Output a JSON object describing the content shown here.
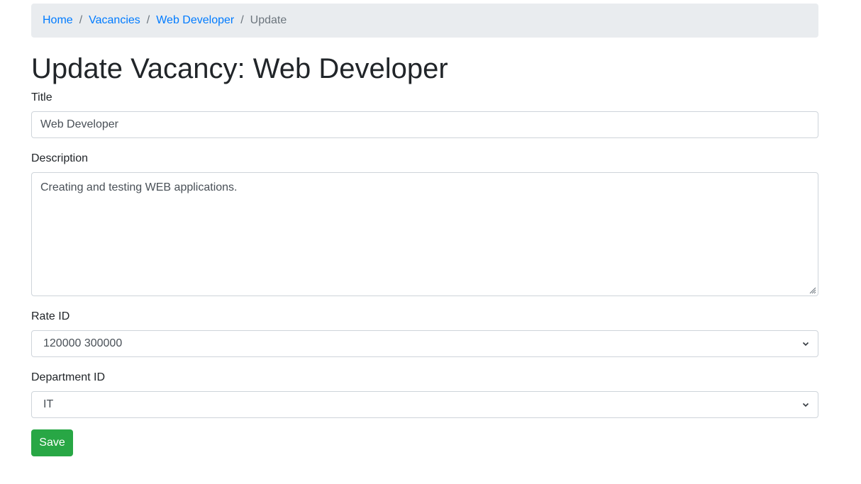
{
  "breadcrumb": {
    "items": [
      {
        "label": "Home"
      },
      {
        "label": "Vacancies"
      },
      {
        "label": "Web Developer"
      }
    ],
    "separator": "/",
    "active": "Update"
  },
  "page": {
    "title": "Update Vacancy: Web Developer"
  },
  "form": {
    "title": {
      "label": "Title",
      "value": "Web Developer"
    },
    "description": {
      "label": "Description",
      "value": "Creating and testing WEB applications."
    },
    "rate": {
      "label": "Rate ID",
      "selected": "120000 300000"
    },
    "department": {
      "label": "Department ID",
      "selected": "IT"
    },
    "save_label": "Save"
  },
  "colors": {
    "link": "#007bff",
    "breadcrumb_bg": "#e9ecef",
    "button_bg": "#28a745",
    "border": "#ced4da"
  }
}
